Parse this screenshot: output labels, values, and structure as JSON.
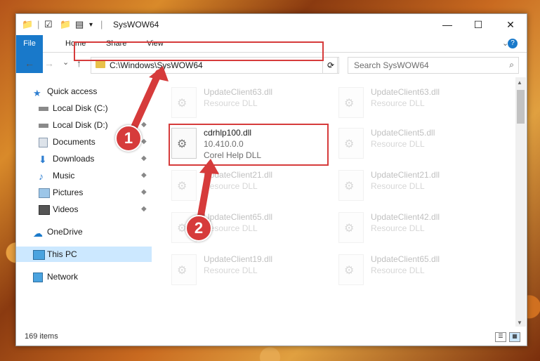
{
  "window": {
    "title": "SysWOW64"
  },
  "window_controls": {
    "minimize": "—",
    "maximize": "☐",
    "close": "✕"
  },
  "ribbon": {
    "tabs": [
      "File",
      "Home",
      "Share",
      "View"
    ],
    "expand": "⌄",
    "help": "?"
  },
  "address": {
    "path": "C:\\Windows\\SysWOW64",
    "dropdown": "⌄",
    "refresh": "⟳"
  },
  "search": {
    "placeholder": "Search SysWOW64",
    "icon": "⌕"
  },
  "nav_buttons": {
    "back": "←",
    "forward": "→",
    "recent": "⌄",
    "up": "↑"
  },
  "sidebar": {
    "items": [
      {
        "label": "Quick access",
        "icon": "star-icon"
      },
      {
        "label": "Local Disk (C:)",
        "icon": "drive-icon"
      },
      {
        "label": "Local Disk (D:)",
        "icon": "drive-icon"
      },
      {
        "label": "Documents",
        "icon": "documents-icon"
      },
      {
        "label": "Downloads",
        "icon": "download-icon"
      },
      {
        "label": "Music",
        "icon": "music-icon"
      },
      {
        "label": "Pictures",
        "icon": "pictures-icon"
      },
      {
        "label": "Videos",
        "icon": "videos-icon"
      },
      {
        "label": "OneDrive",
        "icon": "cloud-icon"
      },
      {
        "label": "This PC",
        "icon": "computer-icon"
      },
      {
        "label": "Network",
        "icon": "network-icon"
      }
    ],
    "pin_glyph": "📌"
  },
  "files": [
    {
      "name": "UpdateClient63.dll",
      "type": "Resource DLL",
      "faded": true
    },
    {
      "name": "UpdateClient63.dll",
      "type": "Resource DLL",
      "faded": true
    },
    {
      "name": "cdrhlp100.dll",
      "version": "10.410.0.0",
      "type": "Corel Help DLL",
      "faded": false
    },
    {
      "name": "UpdateClient5.dll",
      "type": "Resource DLL",
      "faded": true
    },
    {
      "name": "UpdateClient21.dll",
      "type": "Resource DLL",
      "faded": true
    },
    {
      "name": "UpdateClient21.dll",
      "type": "Resource DLL",
      "faded": true
    },
    {
      "name": "UpdateClient65.dll",
      "type": "Resource DLL",
      "faded": true
    },
    {
      "name": "UpdateClient42.dll",
      "type": "Resource DLL",
      "faded": true
    },
    {
      "name": "UpdateClient19.dll",
      "type": "Resource DLL",
      "faded": true
    },
    {
      "name": "UpdateClient65.dll",
      "type": "Resource DLL",
      "faded": true
    }
  ],
  "status": {
    "count": "169 items"
  },
  "annotations": {
    "step1": "1",
    "step2": "2"
  },
  "colors": {
    "accent": "#1979ca",
    "highlight": "#d63b3b"
  }
}
